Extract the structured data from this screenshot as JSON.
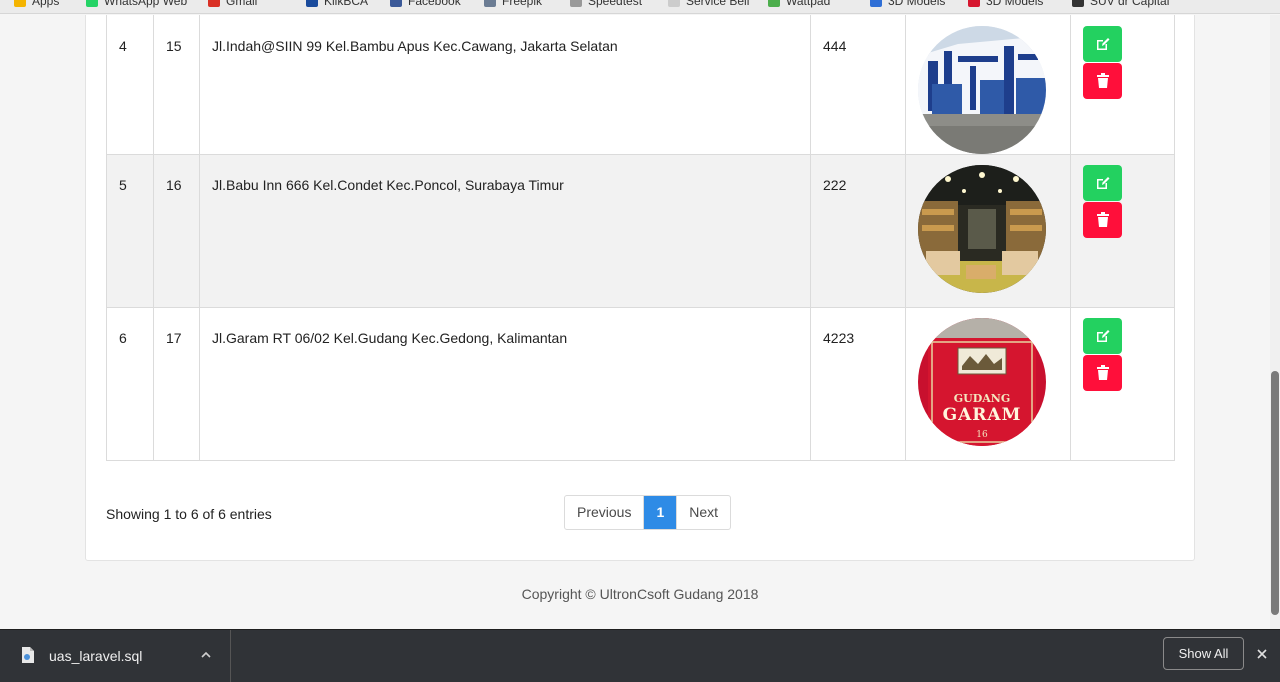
{
  "bookmarks": [
    {
      "label": "Apps",
      "color": "#f4b400"
    },
    {
      "label": "WhatsApp Web",
      "color": "#25d366"
    },
    {
      "label": "Gmail",
      "color": "#d93025"
    },
    {
      "label": "KlikBCA",
      "color": "#1a4b9c"
    },
    {
      "label": "Facebook",
      "color": "#3b5998"
    },
    {
      "label": "Freepik",
      "color": "#6b7c93"
    },
    {
      "label": "Speedtest",
      "color": "#999999"
    },
    {
      "label": "Service Bell",
      "color": "#cccccc"
    },
    {
      "label": "Wattpad",
      "color": "#4cae4c"
    },
    {
      "label": "3D Models",
      "color": "#2f6fd6"
    },
    {
      "label": "3D Models",
      "color": "#d6162f"
    },
    {
      "label": "SUV dr Capital",
      "color": "#333333"
    }
  ],
  "table": {
    "rows": [
      {
        "no": "4",
        "id": "15",
        "address": "Jl.Indah@SIIN 99 Kel.Bambu Apus Kec.Cawang, Jakarta Selatan",
        "capacity": "444",
        "image": "warehouse-exterior"
      },
      {
        "no": "5",
        "id": "16",
        "address": "Jl.Babu Inn 666 Kel.Condet Kec.Poncol, Surabaya Timur",
        "capacity": "222",
        "image": "warehouse-interior"
      },
      {
        "no": "6",
        "id": "17",
        "address": "Jl.Garam RT 06/02 Kel.Gudang Kec.Gedong, Kalimantan",
        "capacity": "4223",
        "image": "gudang-garam-pack"
      }
    ]
  },
  "garam_pack": {
    "line1": "GUDANG",
    "line2": "GARAM",
    "line3": "16"
  },
  "pagination": {
    "info": "Showing 1 to 6 of 6 entries",
    "previous": "Previous",
    "current": "1",
    "next": "Next"
  },
  "footer": {
    "copyright": "Copyright © UltronCsoft Gudang 2018"
  },
  "download_bar": {
    "file_name": "uas_laravel.sql",
    "show_all": "Show All"
  },
  "colors": {
    "edit": "#23d160",
    "delete": "#ff0f3a",
    "page_active": "#2e8be6"
  }
}
